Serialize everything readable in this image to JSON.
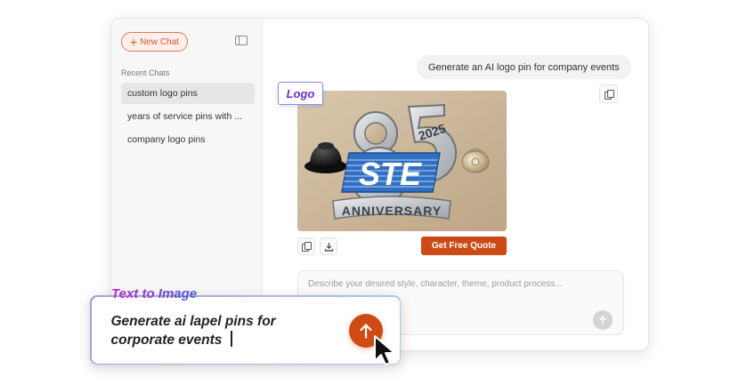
{
  "sidebar": {
    "new_chat_label": "New Chat",
    "new_chat_icon": "plus-icon",
    "toggle_icon": "sidebar-toggle-icon",
    "recent_label": "Recent Chats",
    "items": [
      {
        "label": "custom logo pins",
        "active": true
      },
      {
        "label": "years of service pins with ...",
        "active": false
      },
      {
        "label": "company logo pins",
        "active": false
      }
    ]
  },
  "conversation": {
    "user_message": "Generate an AI logo pin for company events",
    "image_tag": "Logo",
    "image_alt": "85 2025 STE ANNIVERSARY",
    "image_text": {
      "year": "2025",
      "brand": "STE",
      "banner": "ANNIVERSARY",
      "number": "85"
    },
    "quote_button": "Get Free Quote",
    "copy_icon": "copy-icon",
    "download_icon": "download-icon"
  },
  "composer": {
    "placeholder": "Describe your desired style, character, theme, product process...",
    "send_icon": "arrow-up-icon"
  },
  "overlay": {
    "label": "Text to Image",
    "prompt": "Generate ai lapel pins for corporate events",
    "send_icon": "arrow-up-icon",
    "cursor_icon": "mouse-pointer-icon"
  },
  "colors": {
    "accent": "#cc4a14",
    "tag_purple": "#6c2bd9",
    "pin_blue": "#2f6fc4",
    "pin_silver": "#c9cbcd"
  }
}
